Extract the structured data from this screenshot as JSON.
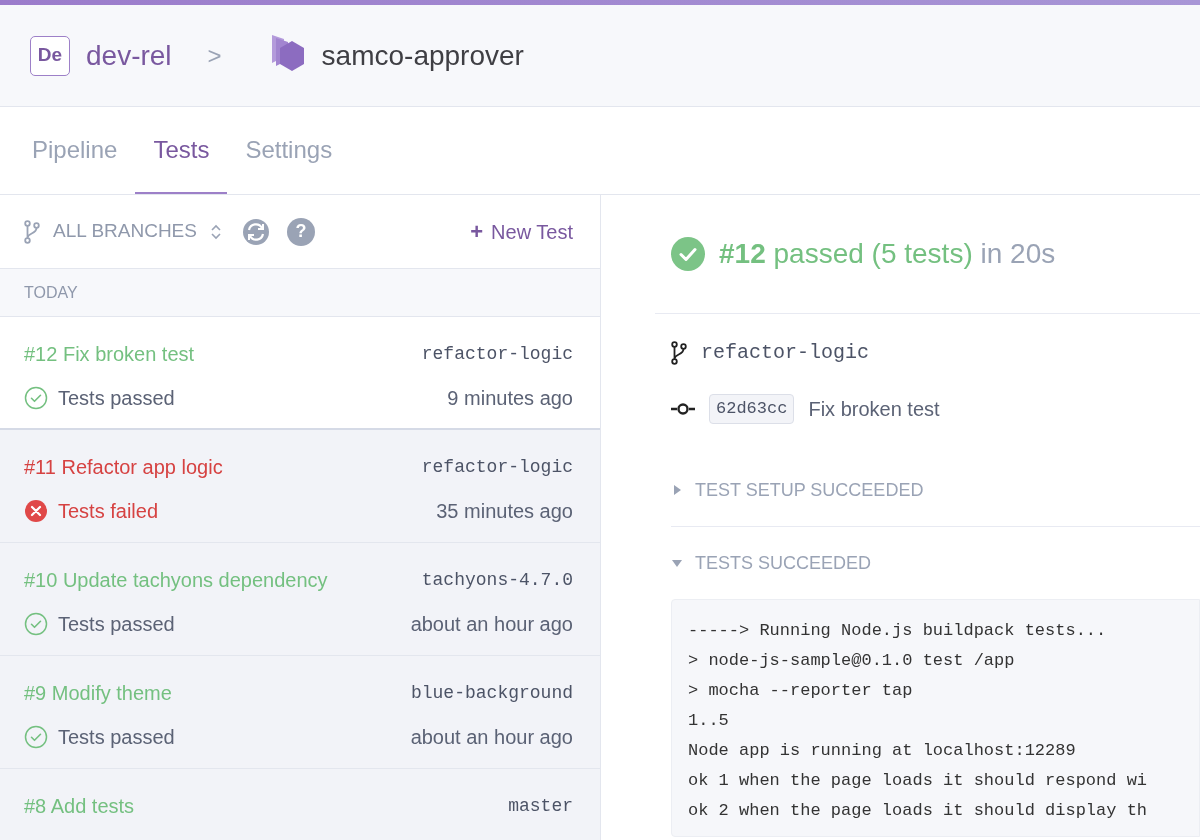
{
  "breadcrumb": {
    "org_badge": "De",
    "org": "dev-rel",
    "separator": ">",
    "app": "samco-approver"
  },
  "tabs": [
    {
      "label": "Pipeline",
      "selected": false
    },
    {
      "label": "Tests",
      "selected": true
    },
    {
      "label": "Settings",
      "selected": false
    }
  ],
  "toolbar": {
    "branch_filter": "ALL BRANCHES",
    "new_test": "New Test",
    "new_test_icon": "+",
    "help": "?"
  },
  "runs_group": "TODAY",
  "runs": [
    {
      "title": "#12 Fix broken test",
      "branch": "refactor-logic",
      "kind": "passed",
      "status_text": "Tests passed",
      "time": "9 minutes ago",
      "selected": true
    },
    {
      "title": "#11 Refactor app logic",
      "branch": "refactor-logic",
      "kind": "failed",
      "status_text": "Tests failed",
      "time": "35 minutes ago",
      "selected": false
    },
    {
      "title": "#10 Update tachyons dependency",
      "branch": "tachyons-4.7.0",
      "kind": "passed",
      "status_text": "Tests passed",
      "time": "about an hour ago",
      "selected": false
    },
    {
      "title": "#9 Modify theme",
      "branch": "blue-background",
      "kind": "passed",
      "status_text": "Tests passed",
      "time": "about an hour ago",
      "selected": false
    },
    {
      "title": "#8 Add tests",
      "branch": "master",
      "kind": "passed",
      "selected": false
    }
  ],
  "detail": {
    "run_number": "#12",
    "result": "passed (5 tests)",
    "duration": "in 20s",
    "kind": "passed",
    "branch": "refactor-logic",
    "commit_sha": "62d63cc",
    "commit_message": "Fix broken test",
    "sections": [
      {
        "title": "TEST SETUP SUCCEEDED",
        "expanded": false
      },
      {
        "title": "TESTS SUCCEEDED",
        "expanded": true,
        "log": [
          "-----> Running Node.js buildpack tests...",
          "> node-js-sample@0.1.0 test /app",
          "> mocha --reporter tap",
          "1..5",
          "Node app is running at localhost:12289",
          "ok 1 when the page loads it should respond wi",
          "ok 2 when the page loads it should display th"
        ]
      }
    ]
  }
}
